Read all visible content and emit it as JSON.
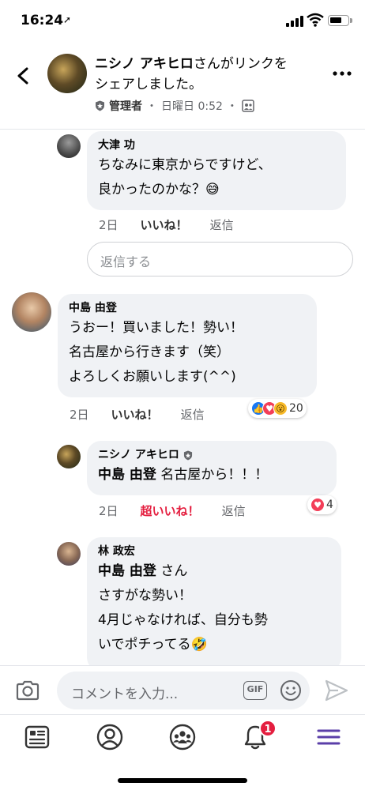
{
  "status_bar": {
    "time": "16:24",
    "location_arrow": "➚"
  },
  "post_header": {
    "author": "ニシノ アキヒロ",
    "action_line1": "さんがリンクを",
    "action_line2": "シェアしました。",
    "role": "管理者",
    "sep1": "・",
    "timestamp": "日曜日 0:52",
    "sep2": "・",
    "icons": [
      "back-chevron-icon",
      "admin-shield-icon",
      "group-audience-icon",
      "more-dots-icon"
    ]
  },
  "comments": [
    {
      "author": "大津 功",
      "lines": [
        "ちなみに東京からですけど、",
        "良かったのかな？😅"
      ],
      "time": "2日",
      "like_label": "いいね！",
      "reply_label": "返信"
    },
    {
      "author": "中島 由登",
      "lines": [
        "うおー！買いました！勢い！",
        "名古屋から行きます（笑）",
        "よろしくお願いします(^^)"
      ],
      "time": "2日",
      "like_label": "いいね！",
      "reply_label": "返信",
      "reaction_count": "20"
    },
    {
      "author": "ニシノ アキヒロ",
      "mention": "中島 由登",
      "text": " 名古屋から！！！",
      "time": "2日",
      "like_label": "超いいね！",
      "reply_label": "返信",
      "reaction_count": "4"
    },
    {
      "author": "林 政宏",
      "mention": "中島 由登",
      "mention_suffix": " さん",
      "lines": [
        "さすがな勢い！",
        "4月じゃなければ、自分も勢",
        "いでポチってる🤣"
      ]
    }
  ],
  "reply_box": {
    "placeholder": "返信する"
  },
  "comment_input": {
    "placeholder": "コメントを入力...",
    "gif_label": "GIF"
  },
  "tab_bar": {
    "notification_badge": "1",
    "icons": [
      "news-feed-icon",
      "profile-icon",
      "groups-icon",
      "notifications-bell-icon",
      "menu-icon"
    ]
  },
  "colors": {
    "accent_blue": "#1877f2",
    "super_like_red": "#e41e3f",
    "menu_purple": "#5b3fa8",
    "bubble_gray": "#f0f2f5"
  }
}
